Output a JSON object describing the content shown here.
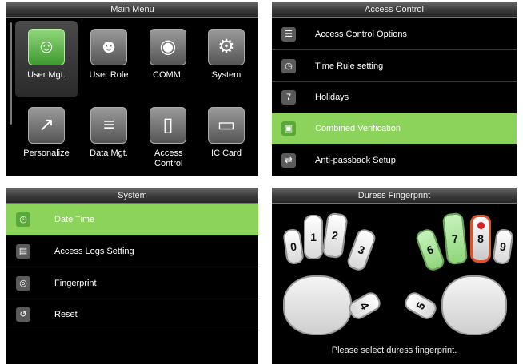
{
  "main_menu": {
    "title": "Main Menu",
    "tiles": [
      {
        "label": "User Mgt.",
        "icon": "user-edit-icon",
        "glyph": "☺"
      },
      {
        "label": "User Role",
        "icon": "user-role-icon",
        "glyph": "☻"
      },
      {
        "label": "COMM.",
        "icon": "wireless-icon",
        "glyph": "◉"
      },
      {
        "label": "System",
        "icon": "gears-icon",
        "glyph": "⚙"
      },
      {
        "label": "Personalize",
        "icon": "chart-icon",
        "glyph": "↗"
      },
      {
        "label": "Data Mgt.",
        "icon": "server-icon",
        "glyph": "≡"
      },
      {
        "label": "Access Control",
        "icon": "door-icon",
        "glyph": "▯"
      },
      {
        "label": "IC Card",
        "icon": "card-icon",
        "glyph": "▭"
      }
    ]
  },
  "access_control": {
    "title": "Access Control",
    "items": [
      {
        "label": "Access Control Options",
        "icon": "options-icon",
        "glyph": "☰"
      },
      {
        "label": "Time Rule setting",
        "icon": "clock-icon",
        "glyph": "◷"
      },
      {
        "label": "Holidays",
        "icon": "calendar-icon",
        "glyph": "7"
      },
      {
        "label": "Combined Verification",
        "icon": "locks-icon",
        "glyph": "▣"
      },
      {
        "label": "Anti-passback Setup",
        "icon": "anti-passback-icon",
        "glyph": "⇄"
      }
    ]
  },
  "system": {
    "title": "System",
    "items": [
      {
        "label": "Date Time",
        "icon": "clock-icon",
        "glyph": "◷"
      },
      {
        "label": "Access Logs Setting",
        "icon": "logs-icon",
        "glyph": "▤"
      },
      {
        "label": "Fingerprint",
        "icon": "fingerprint-icon",
        "glyph": "◎"
      },
      {
        "label": "Reset",
        "icon": "reset-icon",
        "glyph": "↺"
      }
    ]
  },
  "duress": {
    "title": "Duress Fingerprint",
    "fingers": [
      "0",
      "1",
      "2",
      "3",
      "4",
      "5",
      "6",
      "7",
      "8",
      "9"
    ],
    "hint": "Please select duress fingerprint."
  },
  "colors": {
    "accent": "#8bd35b",
    "selected_ring": "#e0502a"
  }
}
